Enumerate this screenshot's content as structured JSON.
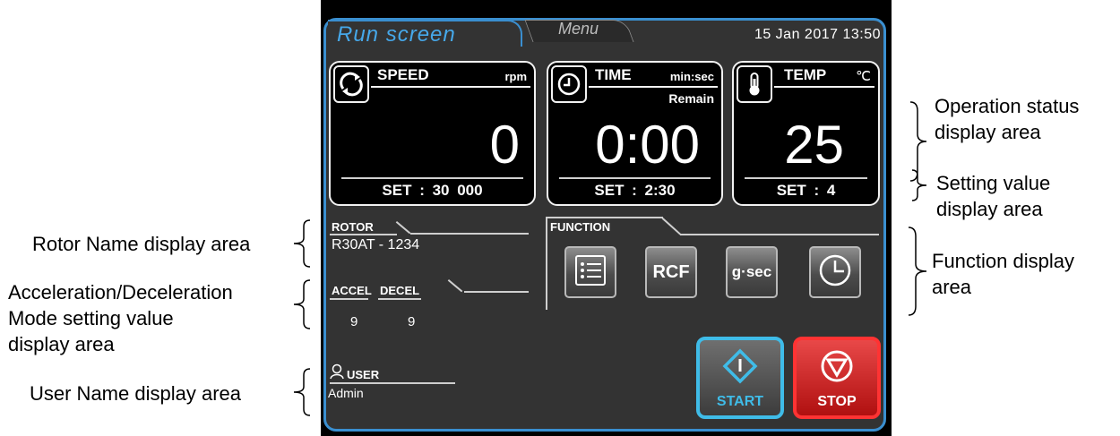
{
  "header": {
    "run_tab": "Run screen",
    "menu_tab": "Menu",
    "datetime": "15 Jan 2017 13:50"
  },
  "status": {
    "speed": {
      "label": "SPEED",
      "unit": "rpm",
      "value": "0",
      "set": "SET : 30 000"
    },
    "time": {
      "label": "TIME",
      "unit": "min:sec",
      "sub": "Remain",
      "value": "0:00",
      "set": "SET : 2:30"
    },
    "temp": {
      "label": "TEMP",
      "unit": "℃",
      "value": "25",
      "set": "SET : 4"
    }
  },
  "rotor": {
    "label": "ROTOR",
    "name": "R30AT - 1234"
  },
  "accel": {
    "accel_label": "ACCEL",
    "decel_label": "DECEL",
    "accel_value": "9",
    "decel_value": "9"
  },
  "user": {
    "label": "USER",
    "name": "Admin"
  },
  "function": {
    "label": "FUNCTION",
    "buttons": [
      {
        "icon": "list-icon"
      },
      {
        "label": "RCF"
      },
      {
        "label": "g·sec"
      },
      {
        "icon": "clock-icon"
      }
    ]
  },
  "controls": {
    "start": "START",
    "stop": "STOP"
  },
  "colors": {
    "accent_blue": "#3a8fd0",
    "start_border": "#3fbce8",
    "stop_red": "#d42020"
  },
  "annotations": {
    "operation_status": [
      "Operation status",
      "display area"
    ],
    "setting_value": [
      "Setting value",
      "display area"
    ],
    "function_display": [
      "Function display",
      "area"
    ],
    "rotor_name": "Rotor Name display area",
    "accel_decel": [
      "Acceleration/Deceleration",
      "Mode setting value",
      "display area"
    ],
    "user_name": "User Name display area"
  }
}
